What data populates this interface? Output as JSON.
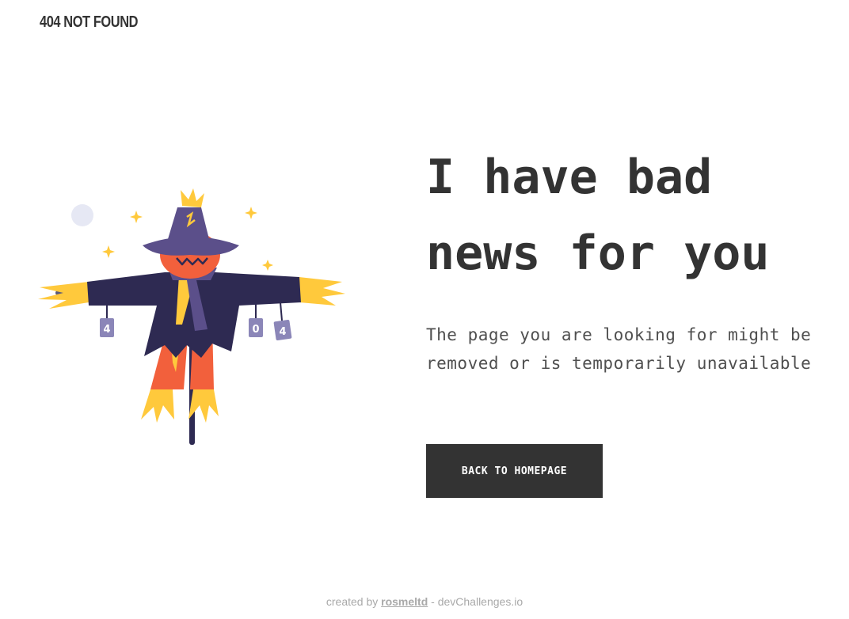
{
  "header": {
    "brand": "404 NOT FOUND"
  },
  "main": {
    "headline_line1": "I have bad",
    "headline_line2": "news for you",
    "message": "The page you are looking for might be removed or is temporarily unavailable",
    "button_label": "BACK TO HOMEPAGE"
  },
  "illustration": {
    "can_left": "4",
    "can_middle": "0",
    "can_right": "4"
  },
  "footer": {
    "prefix": "created by ",
    "author": "rosmeltd",
    "suffix": " - devChallenges.io"
  },
  "colors": {
    "text_dark": "#333333",
    "button_bg": "#333333",
    "footer_text": "#a9a9a9",
    "straw": "#ffc93c",
    "hat": "#5b4f8a",
    "coat": "#2e2a52",
    "face": "#f2603c"
  }
}
